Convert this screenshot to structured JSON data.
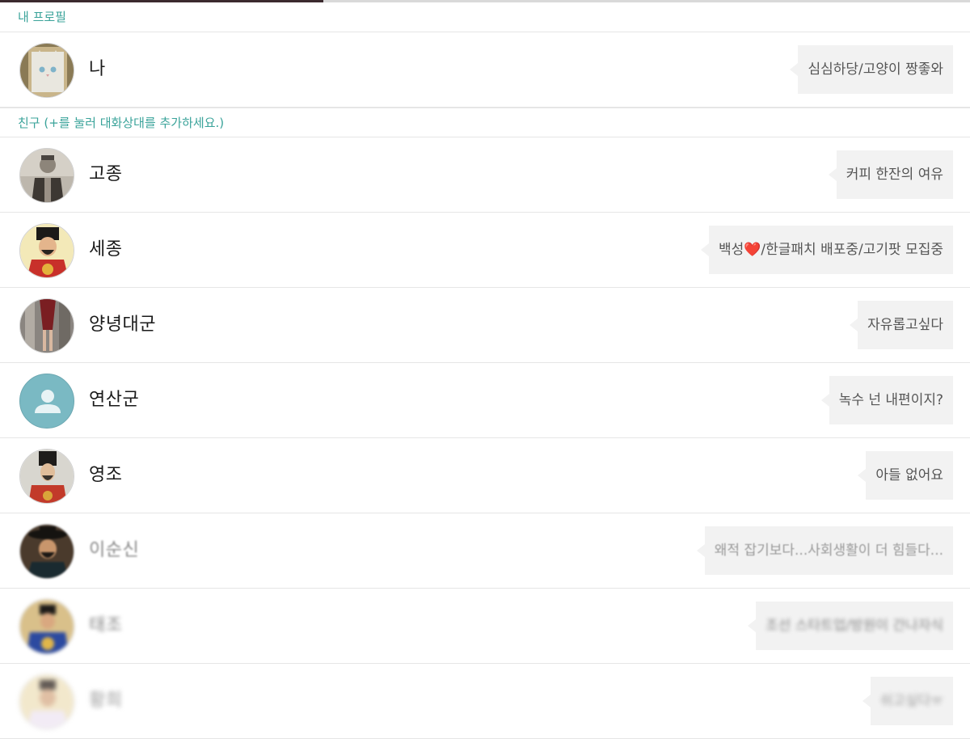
{
  "progress": {
    "fraction": 0.333
  },
  "sections": {
    "my_profile": "내 프로필",
    "friends": "친구 (+를 눌러 대화상대를 추가하세요.)"
  },
  "me": {
    "name": "나",
    "status": "심심하당/고양이 짱좋와",
    "avatar_icon": "cat-photo"
  },
  "friends": [
    {
      "name": "고종",
      "status": "커피 한잔의 여유",
      "avatar_icon": "portrait-photo"
    },
    {
      "name": "세종",
      "status_before": "백성",
      "status_heart": "❤️",
      "status_after": "/한글패치 배포중/고기팟 모집중",
      "avatar_icon": "portrait-photo"
    },
    {
      "name": "양녕대군",
      "status": "자유롭고싶다",
      "avatar_icon": "photo"
    },
    {
      "name": "연산군",
      "status": "녹수 넌 내편이지?",
      "avatar_icon": "default-person-icon"
    },
    {
      "name": "영조",
      "status": "아들 없어요",
      "avatar_icon": "portrait-photo"
    },
    {
      "name": "이순신",
      "status": "왜적 잡기보다...사회생활이 더 힘들다...",
      "avatar_icon": "portrait-photo"
    },
    {
      "name": "태조",
      "status": "조선 스타트업/방원이 간나자식",
      "avatar_icon": "portrait-photo"
    },
    {
      "name": "황희",
      "status": "쉬고싶다ㅠ",
      "avatar_icon": "portrait-photo"
    }
  ]
}
